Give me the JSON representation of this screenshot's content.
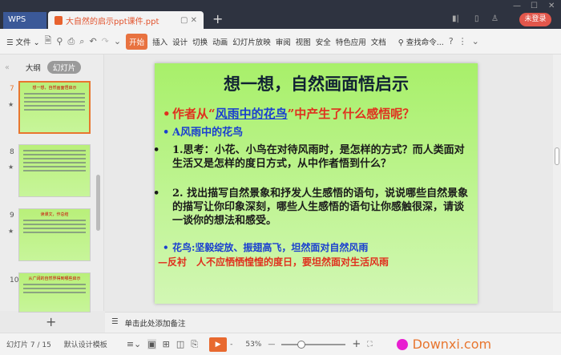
{
  "window": {
    "app_tab": "WPS",
    "doc_tab": "大自然的启示ppt课件.ppt",
    "login": "未登录"
  },
  "toolbar": {
    "file": "文件",
    "tabs": [
      "开始",
      "插入",
      "设计",
      "切换",
      "动画",
      "幻灯片放映",
      "审阅",
      "视图",
      "安全",
      "特色应用",
      "文档"
    ],
    "active_tab": "开始",
    "search": "查找命令..."
  },
  "sidebar": {
    "tabs": [
      "大纲",
      "幻灯片"
    ],
    "active": "幻灯片",
    "thumbnails": [
      {
        "num": "7",
        "title": "想一想，自然画面悟启示",
        "selected": true
      },
      {
        "num": "8",
        "title": "",
        "selected": false
      },
      {
        "num": "9",
        "title": "读课文，作总结",
        "selected": false
      },
      {
        "num": "10",
        "title": "从广阔的自然界得到哪些启示",
        "selected": false
      }
    ]
  },
  "slide": {
    "title": "想一想，自然画面悟启示",
    "q_pre": "作者从“",
    "q_link": "风雨中的花鸟",
    "q_post": "”中产生了什么感悟呢？",
    "a": "A风雨中的花鸟",
    "p1": "1.思考：小花、小鸟在对待风雨时，是怎样的方式？而人类面对生活又是怎样的度日方式，从中作者悟到什么？",
    "p2": "2. 找出描写自然景象和抒发人生感悟的语句，说说哪些自然景象的描写让你印象深刻，哪些人生感悟的语句让你感触很深，请谈一谈你的想法和感受。",
    "p3": "花鸟:坚毅绽放、振翅高飞，坦然面对自然风雨",
    "p4": "—反衬　人不应恓恓惶惶的度日，要坦然面对生活风雨",
    "colors": {
      "red": "#e0301e",
      "blue": "#1a3fd0",
      "dark": "#1a1a1a"
    }
  },
  "notes": {
    "placeholder": "单击此处添加备注"
  },
  "status": {
    "slide_count": "幻灯片 7 / 15",
    "template": "默认设计模板",
    "zoom": "53%",
    "watermark": "Downxi.com"
  }
}
